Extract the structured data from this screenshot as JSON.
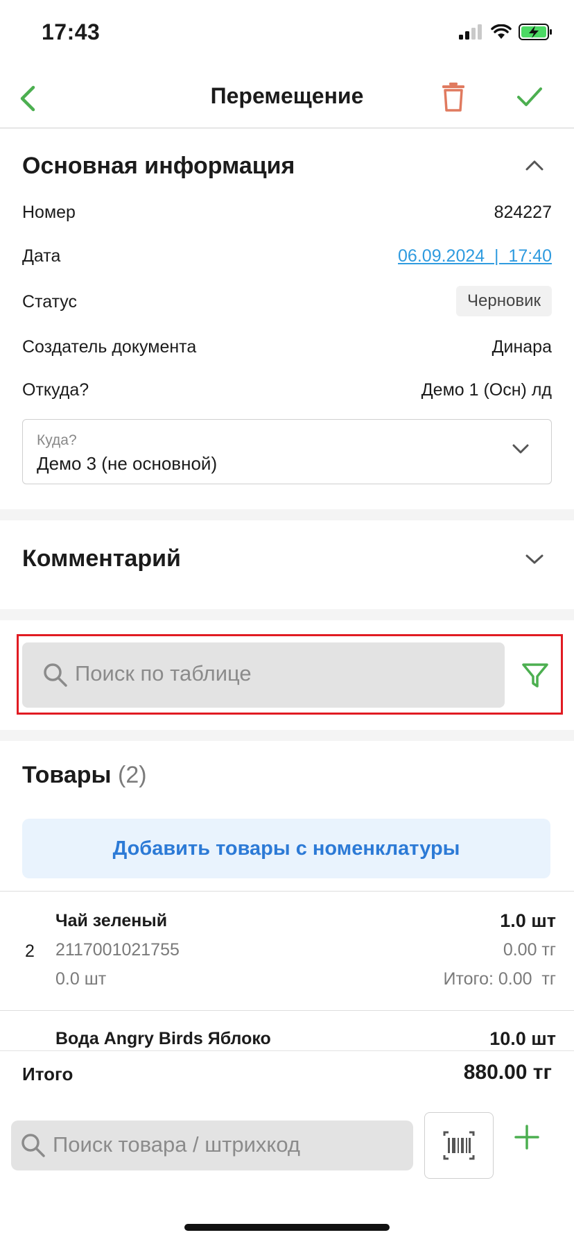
{
  "status_bar": {
    "time": "17:43"
  },
  "navbar": {
    "title": "Перемещение"
  },
  "main_info": {
    "title": "Основная информация",
    "number_label": "Номер",
    "number_value": "824227",
    "date_label": "Дата",
    "date_value": "06.09.2024  |  17:40",
    "status_label": "Статус",
    "status_value": "Черновик",
    "creator_label": "Создатель документа",
    "creator_value": "Динара",
    "from_label": "Откуда?",
    "from_value": "Демо 1 (Осн) лд",
    "to_label": "Куда?",
    "to_value": "Демо 3 (не основной)"
  },
  "comment": {
    "title": "Комментарий"
  },
  "table_search": {
    "placeholder": "Поиск по таблице"
  },
  "products": {
    "title": "Товары",
    "count": "(2)",
    "add_button": "Добавить товары с номенклатуры",
    "items": [
      {
        "index": "2",
        "name": "Чай зеленый",
        "barcode": "2117001021755",
        "stock": "0.0 шт",
        "qty": "1.0 шт",
        "price": "0.00 тг",
        "total": "Итого: 0.00  тг"
      },
      {
        "name": "Вода Angry Birds Яблоко",
        "qty": "10.0 шт"
      }
    ]
  },
  "footer": {
    "total_label": "Итого",
    "total_value": "880.00 тг",
    "search_placeholder": "Поиск товара / штрихкод"
  },
  "colors": {
    "accent_green": "#4caf50",
    "danger": "#e07a5f",
    "link": "#2f9bdf",
    "highlight": "#e11b22"
  }
}
